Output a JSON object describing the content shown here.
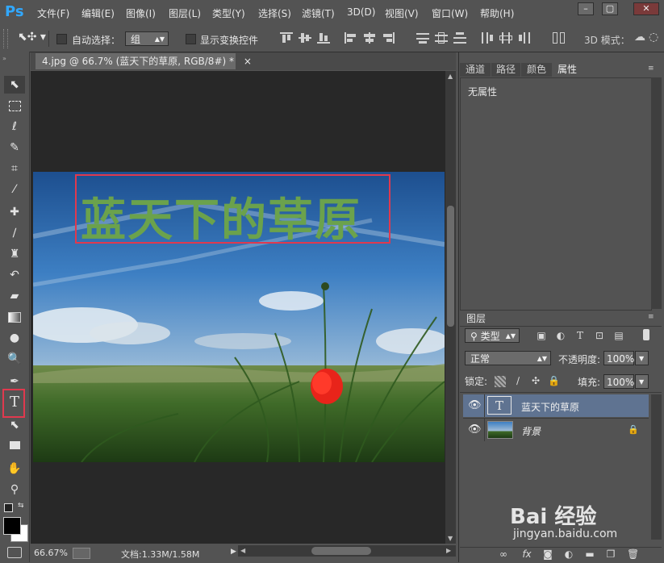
{
  "app": {
    "logo": "Ps"
  },
  "menu": [
    "文件(F)",
    "编辑(E)",
    "图像(I)",
    "图层(L)",
    "类型(Y)",
    "选择(S)",
    "滤镜(T)",
    "3D(D)",
    "视图(V)",
    "窗口(W)",
    "帮助(H)"
  ],
  "window_controls": {
    "minimize": "–",
    "restore": "▢",
    "close": "✕"
  },
  "options": {
    "auto_select_label": "自动选择：",
    "auto_select_value": "组",
    "show_transform_label": "显示变换控件",
    "mode_3d_label": "3D 模式："
  },
  "document": {
    "tab_title": "4.jpg @ 66.7% (蓝天下的草原, RGB/8#) *",
    "tab_close": "×",
    "image_title": "蓝天下的草原"
  },
  "status": {
    "zoom": "66.67%",
    "doc_info": "文档:1.33M/1.58M"
  },
  "panels": {
    "tabs": [
      "通道",
      "路径",
      "颜色",
      "属性"
    ],
    "active_tab": "属性",
    "properties_text": "无属性"
  },
  "layers": {
    "tab_label": "图层",
    "filter_label": "类型",
    "blend_mode": "正常",
    "opacity_label": "不透明度:",
    "opacity_value": "100%",
    "lock_label": "锁定:",
    "fill_label": "填充:",
    "fill_value": "100%",
    "items": [
      {
        "name": "蓝天下的草原",
        "type": "text",
        "thumb": "T"
      },
      {
        "name": "背景",
        "type": "image"
      }
    ]
  },
  "watermark": {
    "brand": "Bai 经验",
    "url": "jingyan.baidu.com"
  },
  "colors": {
    "accent": "#e0394e",
    "title_green": "#6ba24c",
    "selected_row": "#5f7391",
    "ps_blue": "#31a8ff"
  }
}
